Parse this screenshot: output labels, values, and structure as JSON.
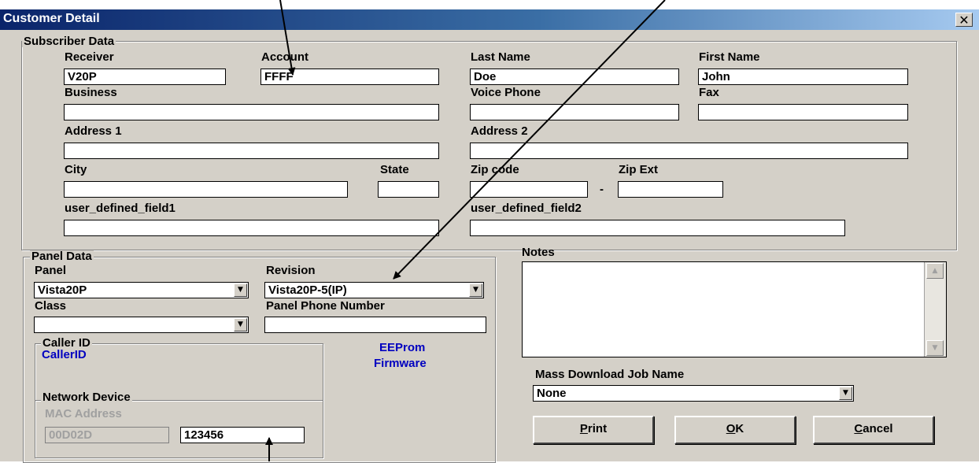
{
  "window": {
    "title": "Customer Detail",
    "close_glyph": "✕"
  },
  "subscriber": {
    "legend": "Subscriber Data",
    "receiver_label": "Receiver",
    "receiver_value": "V20P",
    "account_label": "Account",
    "account_value": "FFFF",
    "last_name_label": "Last Name",
    "last_name_value": "Doe",
    "first_name_label": "First Name",
    "first_name_value": "John",
    "business_label": "Business",
    "business_value": "",
    "voice_phone_label": "Voice Phone",
    "voice_phone_value": "",
    "fax_label": "Fax",
    "fax_value": "",
    "address1_label": "Address 1",
    "address1_value": "",
    "address2_label": "Address 2",
    "address2_value": "",
    "city_label": "City",
    "city_value": "",
    "state_label": "State",
    "state_value": "",
    "zip_label": "Zip code",
    "zip_value": "",
    "zip_sep": "-",
    "zip_ext_label": "Zip Ext",
    "zip_ext_value": "",
    "udf1_label": "user_defined_field1",
    "udf1_value": "",
    "udf2_label": "user_defined_field2",
    "udf2_value": ""
  },
  "panel": {
    "legend": "Panel Data",
    "panel_label": "Panel",
    "panel_value": "Vista20P",
    "revision_label": "Revision",
    "revision_value": "Vista20P-5(IP)",
    "class_label": "Class",
    "class_value": "",
    "phone_label": "Panel Phone Number",
    "phone_value": "",
    "caller_legend": "Caller ID",
    "caller_value": "CallerID",
    "eeprom": "EEProm",
    "firmware": "Firmware",
    "network_legend": "Network Device",
    "mac_label": "MAC Address",
    "mac_prefix": "00D02D",
    "mac_suffix": "123456"
  },
  "notes": {
    "label": "Notes",
    "value": ""
  },
  "mass_download": {
    "label": "Mass Download Job Name",
    "value": "None"
  },
  "buttons": {
    "print_accel": "P",
    "print_rest": "rint",
    "ok_accel": "O",
    "ok_rest": "K",
    "cancel_accel": "C",
    "cancel_rest": "ancel"
  },
  "icons": {
    "dropdown": "chevron-down-icon",
    "scroll_up": "arrow-up-icon",
    "scroll_down": "arrow-down-icon"
  },
  "colors": {
    "title_start": "#0a246a",
    "title_end": "#a6caf0",
    "face": "#d4d0c8",
    "label_blue": "#0000c0"
  }
}
